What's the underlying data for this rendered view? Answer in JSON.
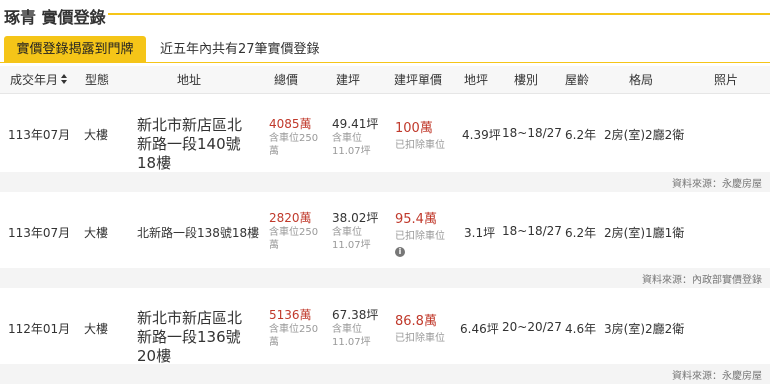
{
  "header": {
    "title": "琢青 實價登錄"
  },
  "tabs": [
    {
      "label": "實價登錄揭露到門牌",
      "active": true
    },
    {
      "label": "近五年內共有27筆實價登錄",
      "active": false
    }
  ],
  "columns": {
    "date": "成交年月",
    "type": "型態",
    "address": "地址",
    "total": "總價",
    "area": "建坪",
    "unit": "建坪單價",
    "land": "地坪",
    "floor": "樓別",
    "age": "屋齡",
    "layout": "格局",
    "photo": "照片"
  },
  "rows": [
    {
      "date": "113年07月",
      "type": "大樓",
      "address": "新北市新店區北新路一段140號18樓",
      "total": "4085萬",
      "total_note": "含車位250萬",
      "area": "49.41坪",
      "area_note1": "含車位",
      "area_note2": "11.07坪",
      "unit": "100萬",
      "unit_note": "已扣除車位",
      "land": "4.39坪",
      "floor": "18~18/27",
      "age": "6.2年",
      "layout": "2房(室)2廳2衛",
      "source": "資料來源：永慶房屋"
    },
    {
      "date": "113年07月",
      "type": "大樓",
      "address": "北新路一段138號18樓",
      "total": "2820萬",
      "total_note": "含車位250萬",
      "area": "38.02坪",
      "area_note1": "含車位",
      "area_note2": "11.07坪",
      "unit": "95.4萬",
      "unit_note": "已扣除車位",
      "land": "3.1坪",
      "floor": "18~18/27",
      "age": "6.2年",
      "layout": "2房(室)1廳1衛",
      "source": "資料來源：內政部實價登錄"
    },
    {
      "date": "112年01月",
      "type": "大樓",
      "address": "新北市新店區北新路一段136號20樓",
      "total": "5136萬",
      "total_note": "含車位250萬",
      "area": "67.38坪",
      "area_note1": "含車位",
      "area_note2": "11.07坪",
      "unit": "86.8萬",
      "unit_note": "已扣除車位",
      "land": "6.46坪",
      "floor": "20~20/27",
      "age": "4.6年",
      "layout": "3房(室)2廳2衛",
      "source": "資料來源：永慶房屋"
    }
  ],
  "colors": {
    "accent": "#f5c518",
    "price": "#c0392b",
    "muted": "#999999"
  },
  "icons": {
    "sort": "sort-icon",
    "info": "info-icon"
  }
}
